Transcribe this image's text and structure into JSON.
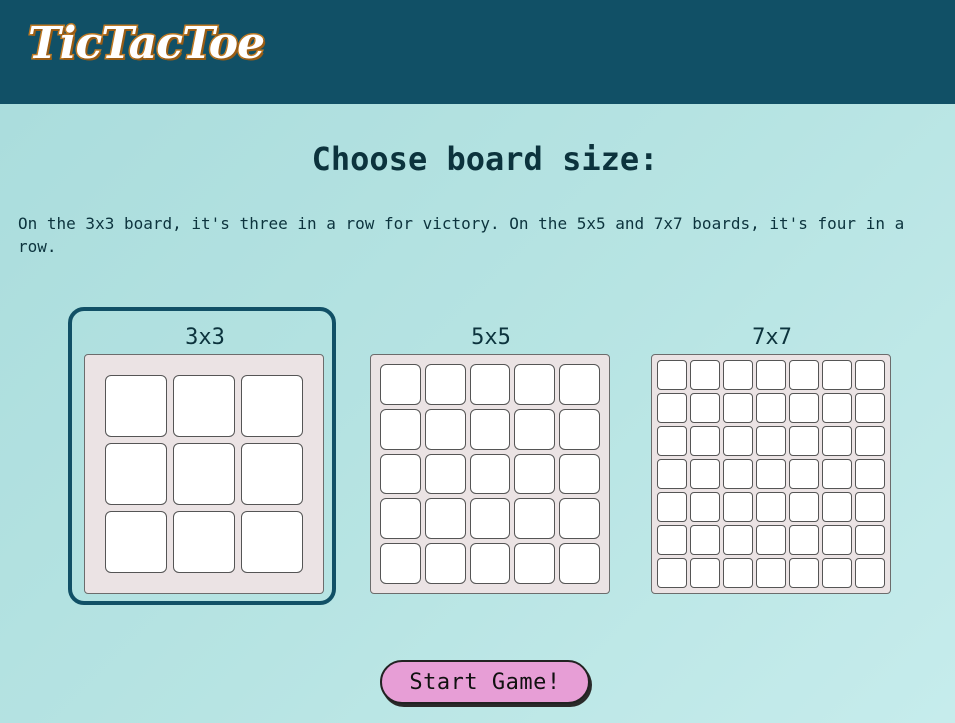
{
  "header": {
    "logo_text": "TicTacToe"
  },
  "main": {
    "title": "Choose board size:",
    "description": "On the 3x3 board, it's three in a row for victory. On the 5x5 and 7x7 boards, it's four in a row.",
    "selected_option": "3x3",
    "options": [
      {
        "label": "3x3",
        "grid": 3
      },
      {
        "label": "5x5",
        "grid": 5
      },
      {
        "label": "7x7",
        "grid": 7
      }
    ],
    "start_label": "Start Game!"
  },
  "colors": {
    "header_bg": "#115066",
    "page_bg": "#b7e4e3",
    "board_bg": "#ebe3e4",
    "selection_border": "#115066",
    "start_button_bg": "#e79ed6",
    "logo_outline": "#c07a24"
  }
}
